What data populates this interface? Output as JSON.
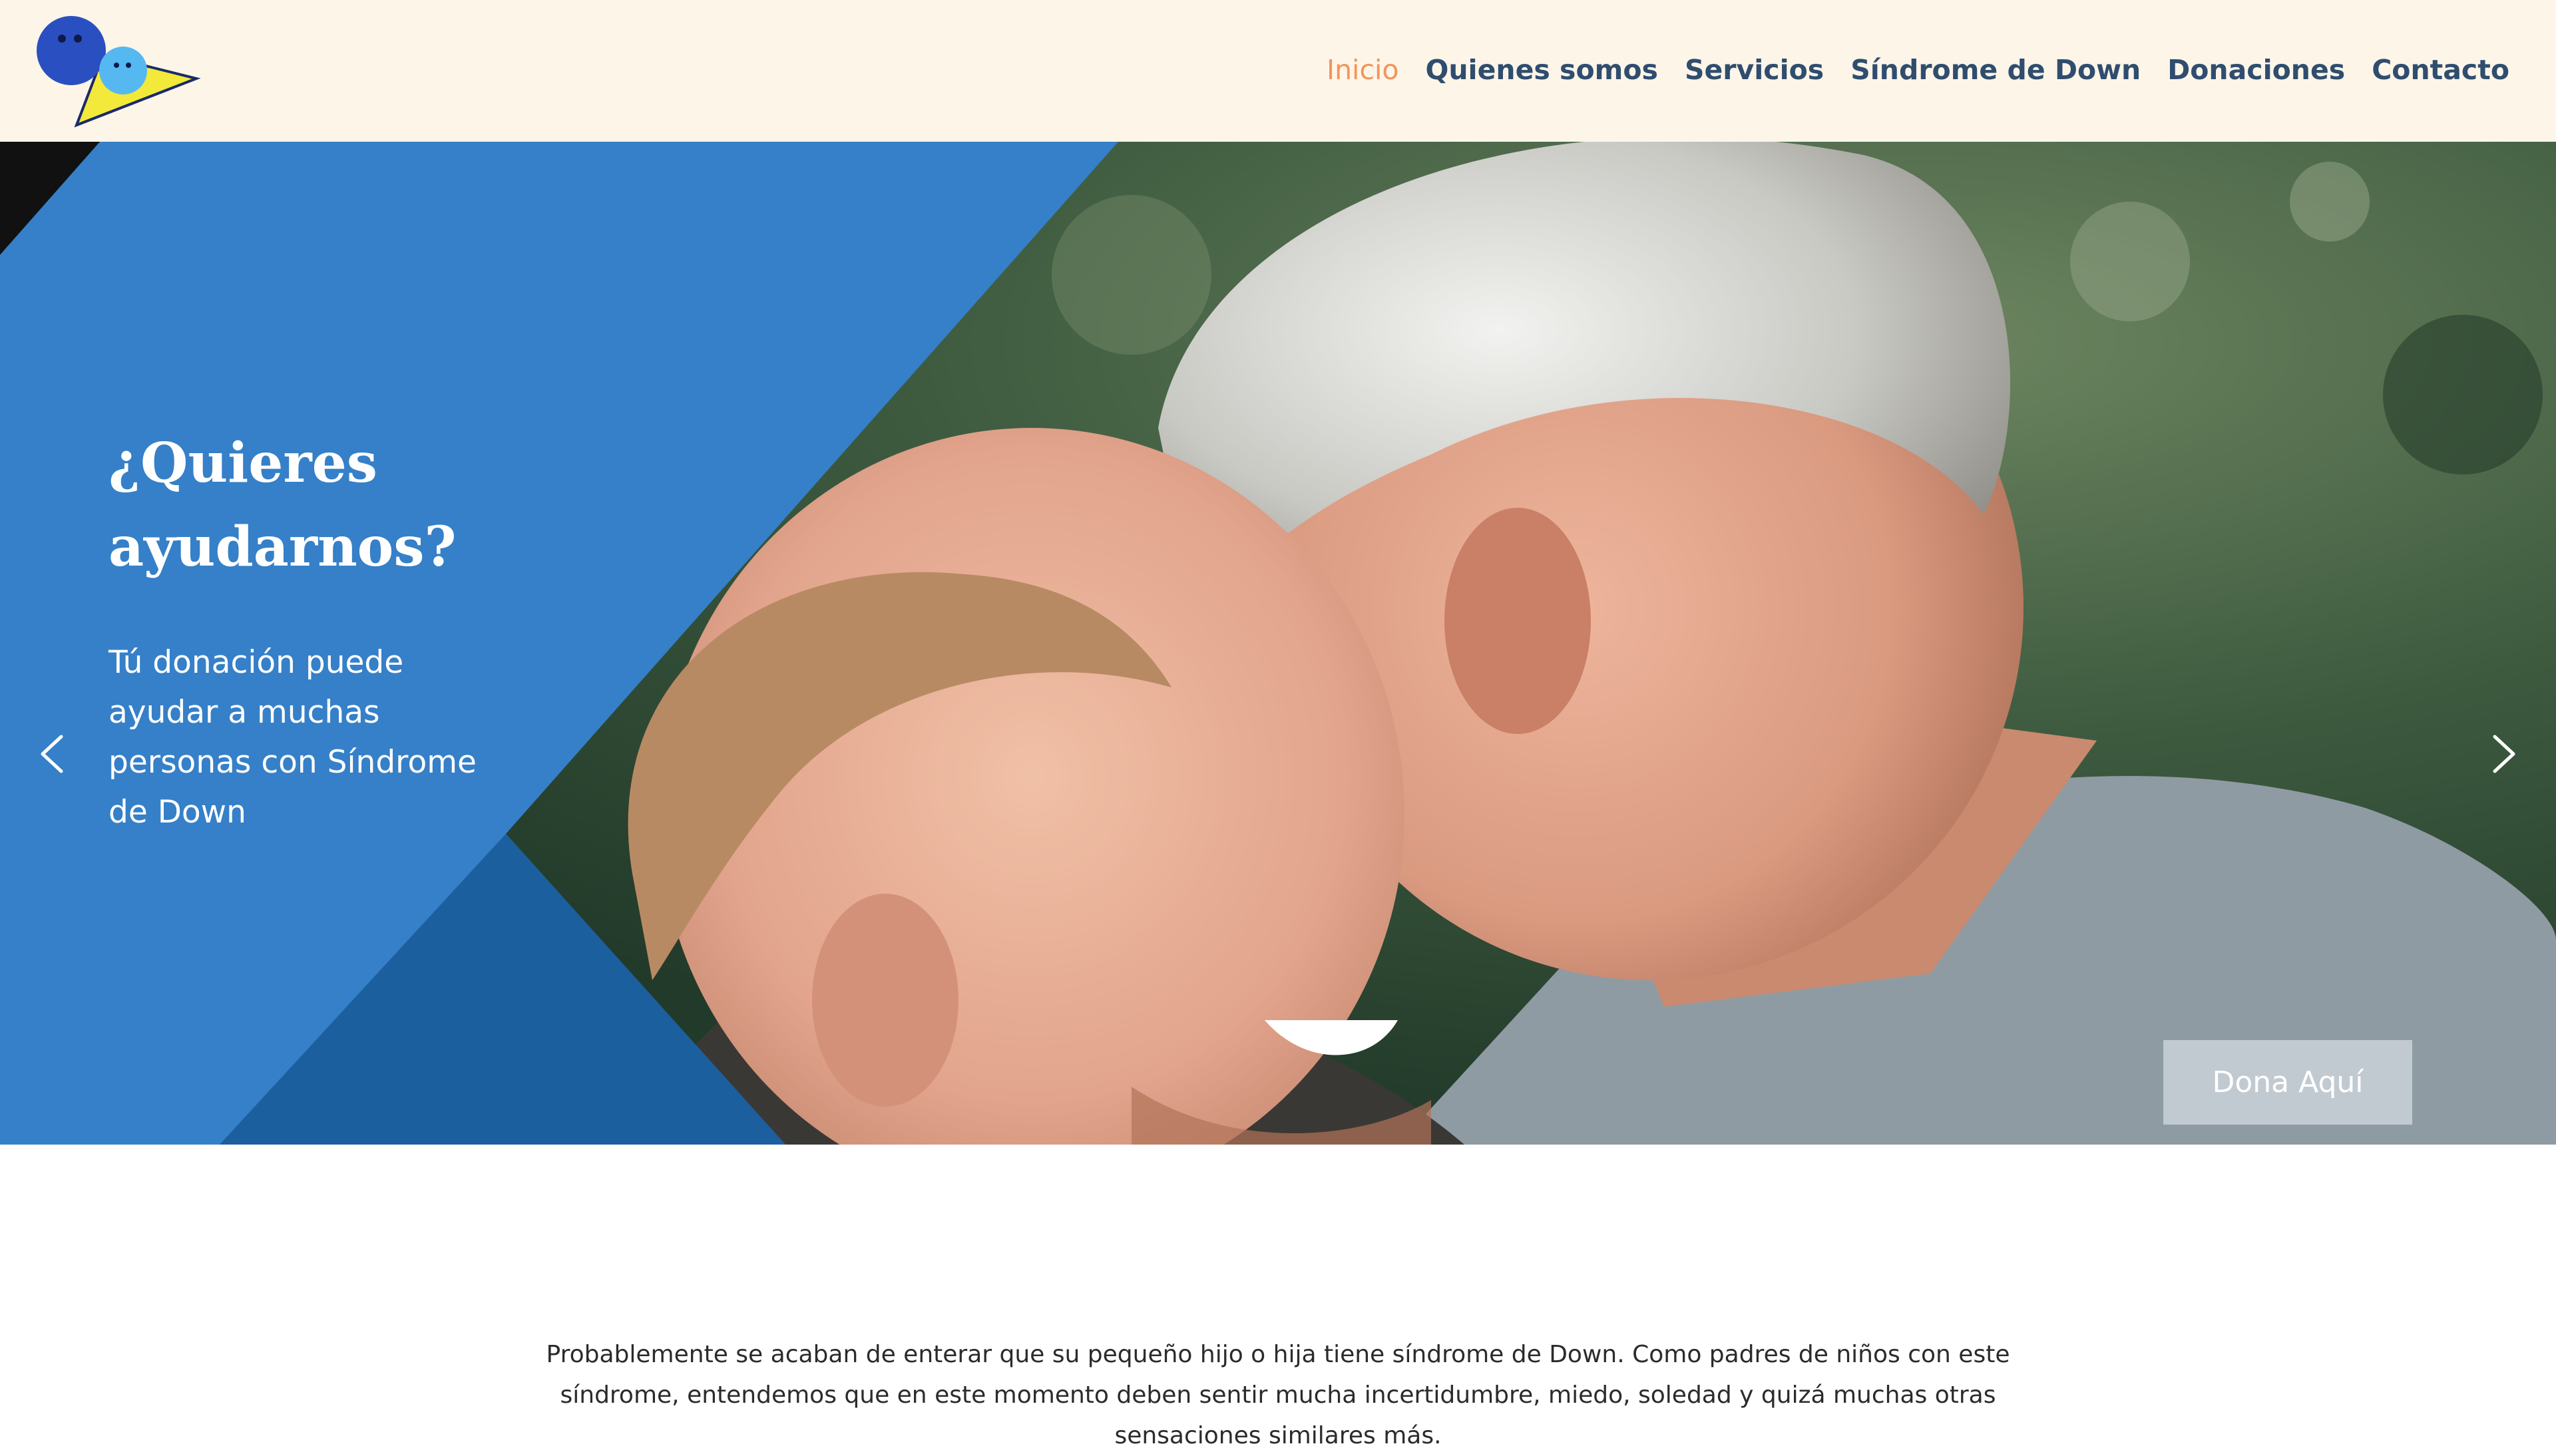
{
  "header": {
    "logo_icon": "smiley-faces-logo",
    "nav": [
      {
        "label": "Inicio",
        "active": true
      },
      {
        "label": "Quienes somos",
        "active": false
      },
      {
        "label": "Servicios",
        "active": false
      },
      {
        "label": "Síndrome de Down",
        "active": false
      },
      {
        "label": "Donaciones",
        "active": false
      },
      {
        "label": "Contacto",
        "active": false
      }
    ]
  },
  "hero": {
    "title": "¿Quieres ayudarnos?",
    "text": "Tú donación puede ayudar a muchas personas con Síndrome de Down",
    "donate_label": "Dona Aquí",
    "prev_icon": "chevron-left-icon",
    "next_icon": "chevron-right-icon"
  },
  "intro": {
    "text": "Probablemente se acaban de enterar que su pequeño hijo o hija tiene síndrome de Down. Como padres de niños con este síndrome, entendemos que en este momento deben sentir mucha incertidumbre, miedo, soledad y quizá muchas otras sensaciones similares más."
  },
  "colors": {
    "header_bg": "#fdf5e8",
    "nav_text": "#2f4d6e",
    "nav_active": "#f2955b",
    "hero_blue": "#3580c8",
    "hero_blue_dark": "#1c5f9f"
  }
}
